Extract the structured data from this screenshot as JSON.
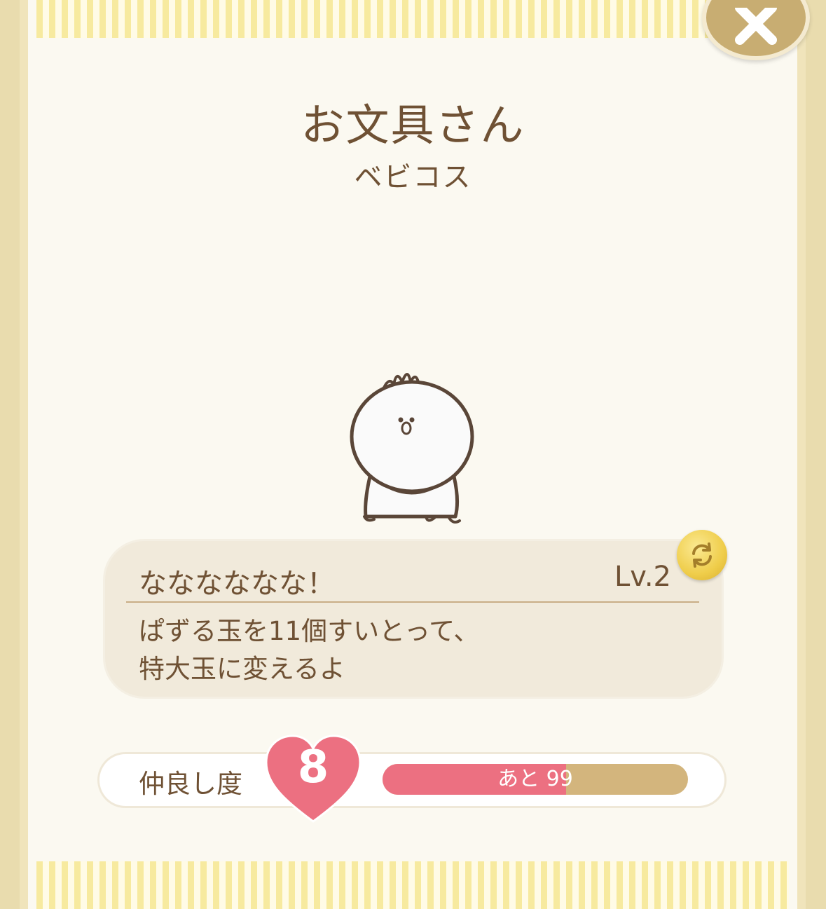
{
  "header": {
    "title": "お文具さん",
    "subtitle": "ベビコス"
  },
  "skill": {
    "name": "なななななな！",
    "level": "Lv.2",
    "description_line1": "ぱずる玉を11個すいとって、",
    "description_line2": "特大玉に変えるよ"
  },
  "friendship": {
    "label": "仲良し度",
    "level": "8",
    "remaining_text": "あと 99",
    "progress": 0.6
  },
  "icons": {
    "close": "close-icon",
    "refresh": "refresh-icon",
    "heart": "heart-icon"
  },
  "colors": {
    "accent_pink": "#ec7081",
    "text_brown": "#6f5134",
    "gold": "#efcd4a"
  }
}
